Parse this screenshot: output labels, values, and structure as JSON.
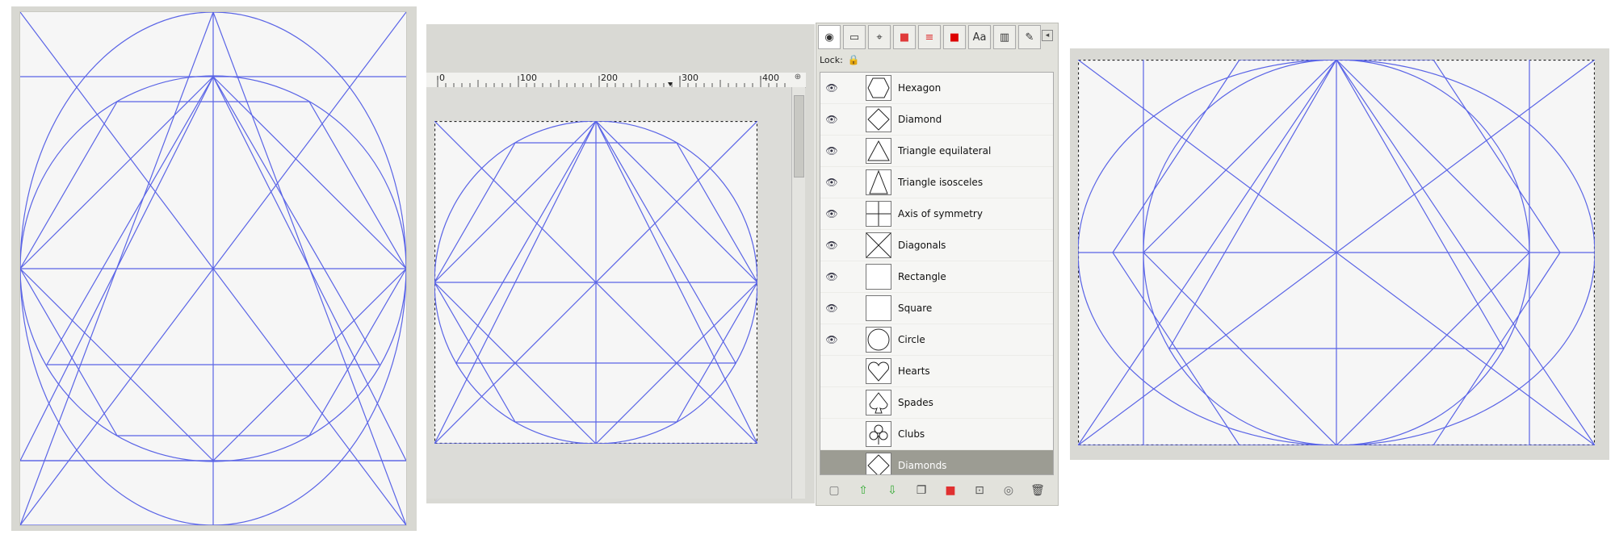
{
  "ruler": {
    "ticks": [
      "0",
      "100",
      "200",
      "300",
      "400"
    ]
  },
  "layers_panel": {
    "lock_label": "Lock:",
    "layers": [
      {
        "name": "Hexagon",
        "visible": true,
        "shape": "hexagon"
      },
      {
        "name": "Diamond",
        "visible": true,
        "shape": "diamond"
      },
      {
        "name": "Triangle equilateral",
        "visible": true,
        "shape": "triangle-eq"
      },
      {
        "name": "Triangle isosceles",
        "visible": true,
        "shape": "triangle-iso"
      },
      {
        "name": "Axis of symmetry",
        "visible": true,
        "shape": "axis"
      },
      {
        "name": "Diagonals",
        "visible": true,
        "shape": "diagonals"
      },
      {
        "name": "Rectangle",
        "visible": true,
        "shape": "rectangle"
      },
      {
        "name": "Square",
        "visible": true,
        "shape": "square"
      },
      {
        "name": "Circle",
        "visible": true,
        "shape": "circle"
      },
      {
        "name": "Hearts",
        "visible": false,
        "shape": "heart"
      },
      {
        "name": "Spades",
        "visible": false,
        "shape": "spade"
      },
      {
        "name": "Clubs",
        "visible": false,
        "shape": "club"
      },
      {
        "name": "Diamonds",
        "visible": false,
        "shape": "diamond",
        "selected": true
      }
    ]
  },
  "colors": {
    "line": "#5a64e6",
    "canvas": "#f6f6f6",
    "selected_row": "#9c9c93"
  }
}
